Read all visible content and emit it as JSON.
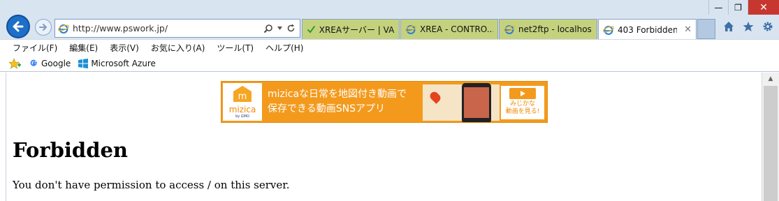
{
  "window": {
    "minimize_label": "—",
    "restore_label": "❐",
    "close_label": "✕"
  },
  "address_bar": {
    "url": "http://www.pswork.jp/"
  },
  "tabs": [
    {
      "label": "XREAサーバー | VA...",
      "icon": "check-icon"
    },
    {
      "label": "XREA - CONTRO...",
      "icon": "ie-page-icon"
    },
    {
      "label": "net2ftp - localhos...",
      "icon": "ie-page-icon"
    },
    {
      "label": "403 Forbidden",
      "icon": "ie-page-icon",
      "active": true
    }
  ],
  "menu": {
    "items": [
      "ファイル(F)",
      "編集(E)",
      "表示(V)",
      "お気に入り(A)",
      "ツール(T)",
      "ヘルプ(H)"
    ]
  },
  "favorites": {
    "items": [
      {
        "label": "Google",
        "icon": "google-icon"
      },
      {
        "label": "Microsoft Azure",
        "icon": "windows-icon"
      }
    ]
  },
  "ad": {
    "logo_text": "mizica",
    "logo_sub": "by GMO",
    "line1": "mizicaな日常を地図付き動画で",
    "line2": "保存できる動画SNSアプリ",
    "cta": "みじかな\n動画を見る!"
  },
  "page": {
    "title": "Forbidden",
    "message": "You don't have permission to access / on this server."
  },
  "colors": {
    "accent": "#1e6fc7",
    "tab_bg": "#c4d27e",
    "ad_orange": "#f39a1d"
  }
}
